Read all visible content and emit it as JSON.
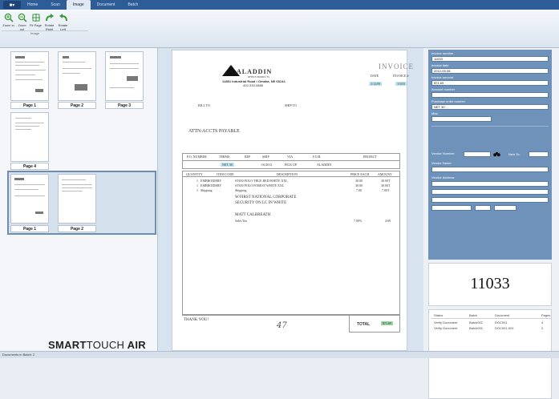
{
  "menu": {
    "app_button": "■▾",
    "tabs": [
      "Home",
      "Scan",
      "Image",
      "Document",
      "Batch"
    ],
    "active_tab": "Image"
  },
  "ribbon": {
    "buttons": [
      {
        "label": "Zoom in",
        "icon": "zoom-in-icon"
      },
      {
        "label": "Zoom out",
        "icon": "zoom-out-icon"
      },
      {
        "label": "Fit Page",
        "icon": "fit-page-icon"
      },
      {
        "label": "Rotate Right",
        "icon": "rotate-right-icon"
      },
      {
        "label": "Rotate Left",
        "icon": "rotate-left-icon"
      }
    ],
    "group_label": "Image"
  },
  "left": {
    "batch1_pages": [
      "Page 1",
      "Page 2",
      "Page 3",
      "Page 4"
    ],
    "batch2_pages": [
      "Page 1",
      "Page 2"
    ],
    "brand_bold": "SMART",
    "brand_light": "TOUCH",
    "brand_tail": " AIR"
  },
  "invoice": {
    "logo": "ALADDIN",
    "tagline": "OFFICE PRODUCTS",
    "address": "14851 Industrial Road • Omaha, NE 68144",
    "phone": "402-333-0888",
    "title": "INVOICE",
    "date_lbl": "DATE",
    "inv_lbl": "INVOICE #",
    "date_val": "2/12/09",
    "inv_val": "11033",
    "bill_to": "BILL TO",
    "ship_to": "SHIP TO",
    "attention": "ATTN:ACCTS PAYABLE",
    "headers1": [
      "P.O. NUMBER",
      "TERMS",
      "REP",
      "SHIP",
      "VIA",
      "F.O.B.",
      "PROJECT"
    ],
    "row1": [
      "NET 30",
      "1/6/2012",
      "PICK UP",
      "ALADDIN"
    ],
    "headers2": [
      "QUANTITY",
      "ITEM CODE",
      "DESCRIPTION",
      "PRICE EACH",
      "AMOUNT"
    ],
    "lines": [
      {
        "qty": "1",
        "code": "EMBROIDERY",
        "desc": "ST650 POLO TRUE RED/WHITE XXL",
        "price": "30.00",
        "amount": "30.00T"
      },
      {
        "qty": "1",
        "code": "EMBROIDERY",
        "desc": "ST650 POLO FOREST/WHITE XXL",
        "price": "30.00",
        "amount": "30.00T"
      },
      {
        "qty": "1",
        "code": "Shipping",
        "desc": "Shipping",
        "price": "7.00",
        "amount": "7.00T"
      },
      {
        "qty": "",
        "code": "",
        "desc": "W/FIRST NATIONAL CORPORATE",
        "price": "",
        "amount": ""
      },
      {
        "qty": "",
        "code": "",
        "desc": "SECURITY ON LC IN WHITE",
        "price": "",
        "amount": ""
      },
      {
        "qty": "",
        "code": "",
        "desc": "MATT CALBREATH",
        "price": "",
        "amount": ""
      },
      {
        "qty": "",
        "code": "",
        "desc": "Sales Tax",
        "price": "7.00%",
        "amount": "4.69"
      }
    ],
    "thanks": "THANK YOU!",
    "handwriting": "47",
    "total_lbl": "TOTAL",
    "total_val": "$71.69"
  },
  "fields": [
    {
      "label": "Invoice number",
      "value": "11033"
    },
    {
      "label": "Invoice date",
      "value": "2012-05-08"
    },
    {
      "label": "Invoice amount",
      "value": "$71.69"
    },
    {
      "label": "Account number",
      "value": ""
    },
    {
      "label": "Purchase order number",
      "value": "NET 30"
    },
    {
      "label": "Misc",
      "value": ""
    }
  ],
  "vendor": {
    "number_lbl": "Vendor Number:",
    "next_lbl": "Next To:",
    "name_lbl": "Vendor Name:",
    "address_lbl": "Vendor Address:"
  },
  "zoom_value": "11033",
  "grid": {
    "headers": [
      "Status",
      "Batch",
      "Document",
      "Pages"
    ],
    "rows": [
      [
        "Verify Document",
        "Batch002",
        "DOC001",
        "4"
      ],
      [
        "Verify Document",
        "Batch002",
        "DOC001-001",
        "2"
      ]
    ]
  },
  "status": "Documents in Batch: 2",
  "colors": {
    "menubar": "#2d5c97",
    "fieldpane": "#6f92ba",
    "accent_green": "#3c9a3c"
  }
}
